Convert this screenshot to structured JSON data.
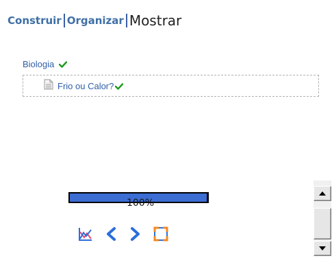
{
  "nav": {
    "tab_build": "Construir",
    "tab_organize": "Organizar",
    "tab_show": "Mostrar"
  },
  "tree": {
    "root_label": "Biologia",
    "child_label": "Frio ou Calor?"
  },
  "progress": {
    "value_percent": 100,
    "label": "100%"
  },
  "controls": {
    "icons": [
      "chart-icon",
      "previous-icon",
      "next-icon",
      "fullscreen-icon"
    ]
  },
  "colors": {
    "link": "#3f6fa6",
    "check": "#1a9a1a",
    "progress_fill": "#3c6dd3",
    "accent_blue": "#2a6fd9",
    "fullscreen_orange": "#f08a24"
  }
}
